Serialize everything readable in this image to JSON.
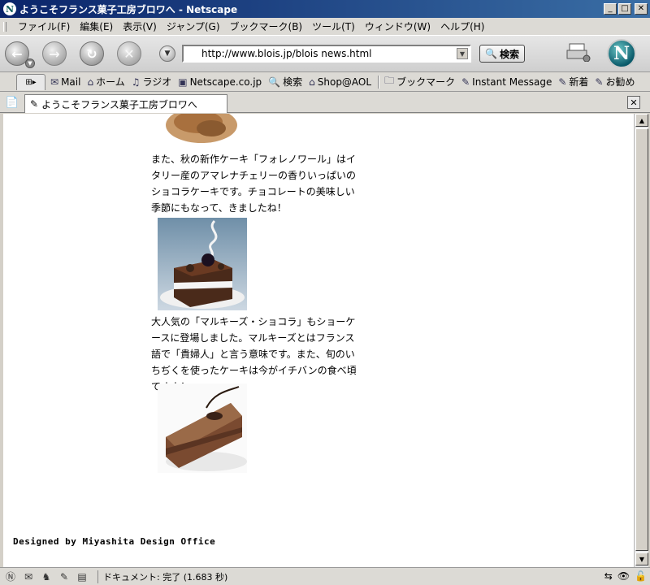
{
  "window": {
    "title": "ようこそフランス菓子工房ブロワへ - Netscape"
  },
  "menu": [
    "ファイル(F)",
    "編集(E)",
    "表示(V)",
    "ジャンプ(G)",
    "ブックマーク(B)",
    "ツール(T)",
    "ウィンドウ(W)",
    "ヘルプ(H)"
  ],
  "nav": {
    "url": "http://www.blois.jp/blois news.html",
    "search_label": "検索"
  },
  "personal_toolbar": {
    "items": [
      "Mail",
      "ホーム",
      "ラジオ",
      "Netscape.co.jp",
      "検索",
      "Shop@AOL"
    ],
    "bookmarks": [
      "ブックマーク",
      "Instant Message",
      "新着",
      "お勧め"
    ]
  },
  "tab": {
    "title": "ようこそフランス菓子工房ブロワへ"
  },
  "content": {
    "paragraph1": "また、秋の新作ケーキ「フォレノワール」はイタリー産のアマレナチェリーの香りいっぱいのショコラケーキです。チョコレートの美味しい季節にもなって、きましたね！",
    "paragraph2": "大人気の「マルキーズ・ショコラ」もショーケースに登場しました。マルキーズとはフランス語で「貴婦人」と言う意味です。また、旬のいちぢくを使ったケーキは今がイチバンの食べ頃ですよ！",
    "credit": "Designed by Miyashita Design Office"
  },
  "status": {
    "text": "ドキュメント: 完了 (1.683 秒)"
  },
  "colors": {
    "titlebar_start": "#0a246a",
    "titlebar_end": "#3a6ea5",
    "chrome": "#d4d0c8"
  }
}
